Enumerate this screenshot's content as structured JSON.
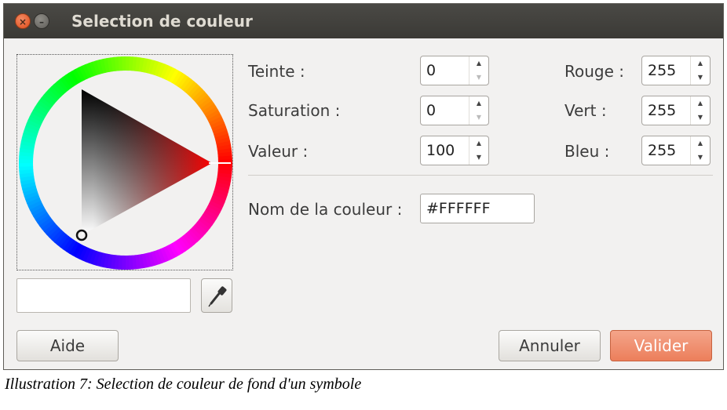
{
  "window": {
    "title": "Selection de couleur"
  },
  "hsv": {
    "hue": {
      "label": "Teinte :",
      "value": "0"
    },
    "saturation": {
      "label": "Saturation :",
      "value": "0"
    },
    "value": {
      "label": "Valeur :",
      "value": "100"
    }
  },
  "rgb": {
    "red": {
      "label": "Rouge :",
      "value": "255"
    },
    "green": {
      "label": "Vert :",
      "value": "255"
    },
    "blue": {
      "label": "Bleu :",
      "value": "255"
    }
  },
  "color_name": {
    "label": "Nom de la couleur :",
    "value": "#FFFFFF"
  },
  "buttons": {
    "help": "Aide",
    "cancel": "Annuler",
    "ok": "Valider"
  },
  "caption": "Illustration 7: Selection de couleur de fond d'un symbole",
  "colors": {
    "accent": "#ec7f5b",
    "titlebar": "#3c3b37",
    "current_color": "#ffffff"
  }
}
